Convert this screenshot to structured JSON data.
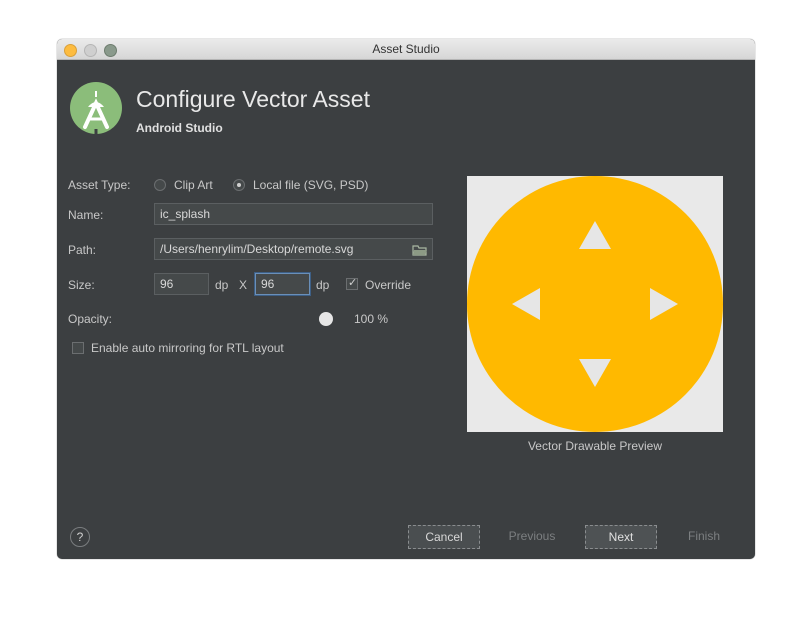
{
  "window": {
    "title": "Asset Studio"
  },
  "header": {
    "title": "Configure Vector Asset",
    "subtitle": "Android Studio",
    "logo_icon": "android-studio-logo-icon"
  },
  "form": {
    "asset_type_label": "Asset Type:",
    "asset_type_options": [
      {
        "label": "Clip Art",
        "selected": false
      },
      {
        "label": "Local file (SVG, PSD)",
        "selected": true
      }
    ],
    "name_label": "Name:",
    "name_value": "ic_splash",
    "path_label": "Path:",
    "path_value": "/Users/henrylim/Desktop/remote.svg",
    "path_browse_icon": "folder-icon",
    "size_label": "Size:",
    "width_value": "96",
    "width_unit": "dp",
    "size_separator": "X",
    "height_value": "96",
    "height_unit": "dp",
    "override_label": "Override",
    "override_checked": true,
    "opacity_label": "Opacity:",
    "opacity_value": "100 %",
    "opacity_level": 1.0,
    "rtl_label": "Enable auto mirroring for RTL layout",
    "rtl_checked": false
  },
  "preview": {
    "label": "Vector Drawable Preview",
    "circle_color": "#ffb900",
    "arrow_color": "#e6e6e6",
    "background_color": "#e9e9e9"
  },
  "footer": {
    "help_label": "?",
    "cancel_label": "Cancel",
    "previous_label": "Previous",
    "next_label": "Next",
    "finish_label": "Finish"
  }
}
